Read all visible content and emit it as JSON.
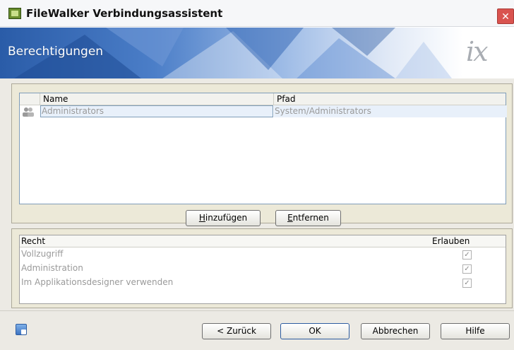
{
  "window": {
    "title": "FileWalker Verbindungsassistent",
    "close_glyph": "✕"
  },
  "banner": {
    "title": "Berechtigungen",
    "logo_text": "ix"
  },
  "users_list": {
    "columns": [
      "Name",
      "Pfad"
    ],
    "rows": [
      {
        "icon": "users-group-icon",
        "name": "Administrators",
        "path": "System/Administrators"
      }
    ]
  },
  "list_buttons": {
    "add_label": "Hinzufügen",
    "add_mnemonic": "H",
    "add_rest": "inzufügen",
    "remove_label": "Entfernen",
    "remove_mnemonic": "E",
    "remove_rest": "ntfernen"
  },
  "rights": {
    "col_right": "Recht",
    "col_allow": "Erlauben",
    "rows": [
      {
        "label": "Vollzugriff",
        "allowed": true
      },
      {
        "label": "Administration",
        "allowed": true
      },
      {
        "label": "Im Applikationsdesigner verwenden",
        "allowed": true
      }
    ]
  },
  "footer": {
    "help_icon": "help-window-icon",
    "back_label": "< Zurück",
    "ok_label": "OK",
    "cancel_label": "Abbrechen",
    "help_label": "Hilfe"
  },
  "colors": {
    "banner_blue": "#2a5ca8",
    "close_red": "#d9534f",
    "selection": "#e8f0fa",
    "disabled_text": "#9a9a9a"
  }
}
